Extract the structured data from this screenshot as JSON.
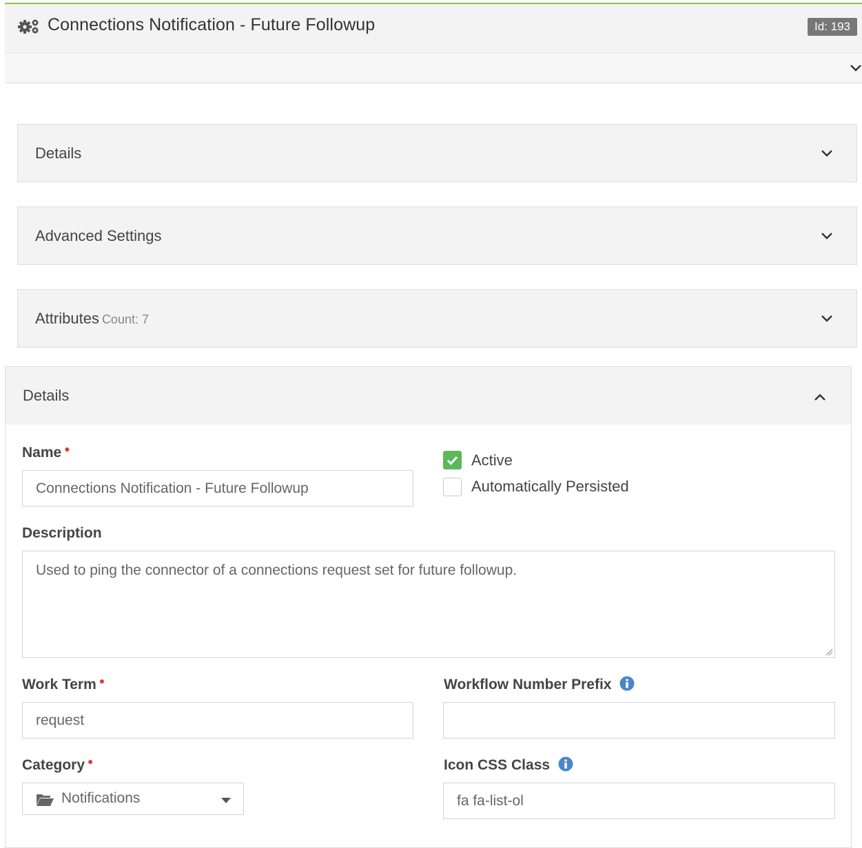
{
  "header": {
    "title": "Connections Notification - Future Followup",
    "id_badge": "Id: 193"
  },
  "panels": [
    {
      "title": "Details",
      "count": ""
    },
    {
      "title": "Advanced Settings",
      "count": ""
    },
    {
      "title": "Attributes",
      "count": "Count: 7"
    }
  ],
  "details": {
    "title": "Details",
    "name_label": "Name",
    "name_value": "Connections Notification - Future Followup",
    "active_label": "Active",
    "active_checked": true,
    "persisted_label": "Automatically Persisted",
    "persisted_checked": false,
    "description_label": "Description",
    "description_value": "Used to ping the connector of a connections request set for future followup.",
    "work_term_label": "Work Term",
    "work_term_value": "request",
    "prefix_label": "Workflow Number Prefix",
    "prefix_value": "",
    "category_label": "Category",
    "category_value": "Notifications",
    "icon_css_label": "Icon CSS Class",
    "icon_css_value": "fa fa-list-ol"
  },
  "colors": {
    "accent_green": "#8bc34a",
    "required_dot": "#e53935",
    "info_blue": "#4a86c8",
    "check_green": "#5cb85c"
  },
  "icons": [
    "gears-icon",
    "chevron-down-icon",
    "chevron-up-icon",
    "info-icon",
    "folder-open-icon",
    "caret-down-icon",
    "check-icon"
  ]
}
